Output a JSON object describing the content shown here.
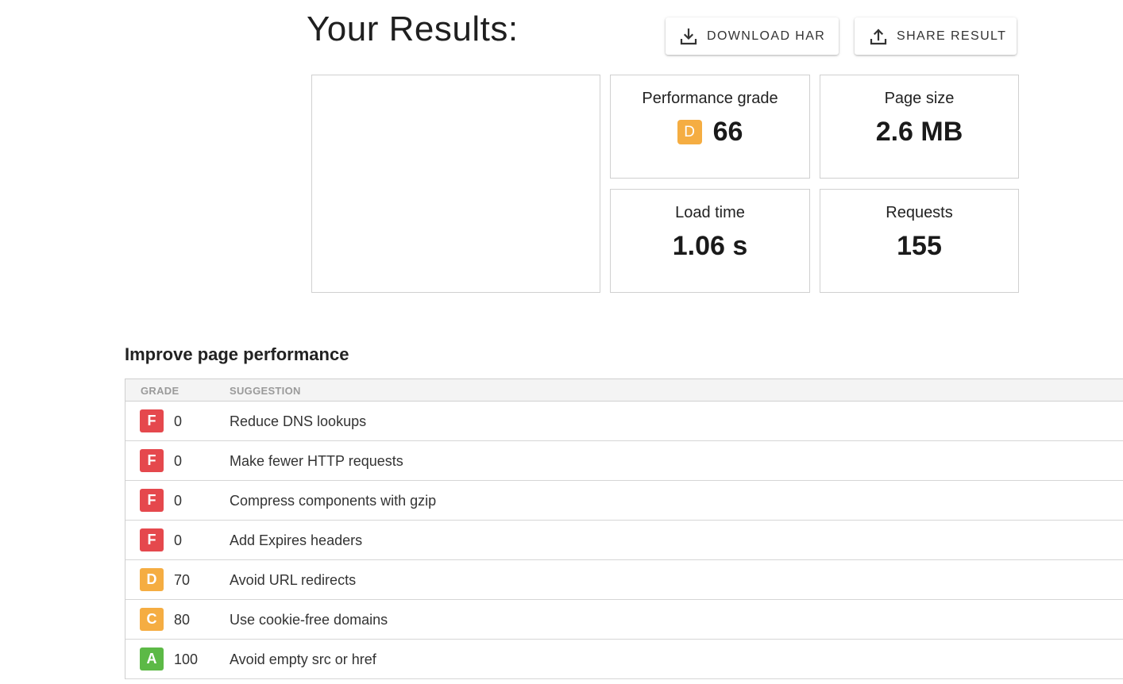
{
  "header": {
    "title": "Your Results:",
    "download_button": "DOWNLOAD HAR",
    "share_button": "SHARE RESULT"
  },
  "metrics": {
    "performance_grade": {
      "label": "Performance grade",
      "letter": "D",
      "value": "66"
    },
    "page_size": {
      "label": "Page size",
      "value": "2.6 MB"
    },
    "load_time": {
      "label": "Load time",
      "value": "1.06 s"
    },
    "requests": {
      "label": "Requests",
      "value": "155"
    }
  },
  "improve": {
    "title": "Improve page performance",
    "columns": {
      "grade": "GRADE",
      "suggestion": "SUGGESTION"
    },
    "rows": [
      {
        "letter": "F",
        "score": "0",
        "suggestion": "Reduce DNS lookups",
        "color": "#e5484d"
      },
      {
        "letter": "F",
        "score": "0",
        "suggestion": "Make fewer HTTP requests",
        "color": "#e5484d"
      },
      {
        "letter": "F",
        "score": "0",
        "suggestion": "Compress components with gzip",
        "color": "#e5484d"
      },
      {
        "letter": "F",
        "score": "0",
        "suggestion": "Add Expires headers",
        "color": "#e5484d"
      },
      {
        "letter": "D",
        "score": "70",
        "suggestion": "Avoid URL redirects",
        "color": "#f5ad42"
      },
      {
        "letter": "C",
        "score": "80",
        "suggestion": "Use cookie-free domains",
        "color": "#f5ad42"
      },
      {
        "letter": "A",
        "score": "100",
        "suggestion": "Avoid empty src or href",
        "color": "#5cb946"
      }
    ]
  },
  "colors": {
    "grade_d": "#f5ad42",
    "grade_f": "#e5484d",
    "grade_c": "#f5ad42",
    "grade_a": "#5cb946"
  }
}
